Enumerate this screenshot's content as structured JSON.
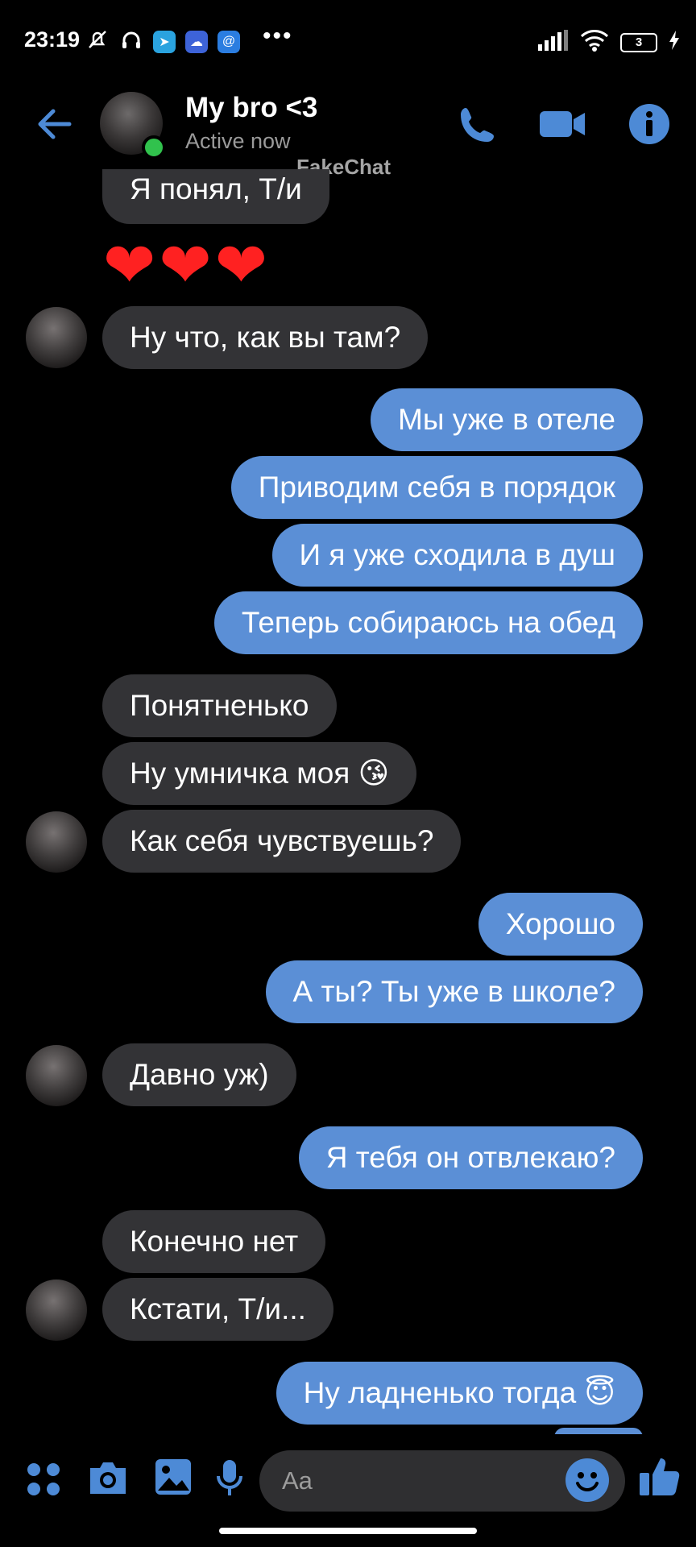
{
  "status_bar": {
    "time": "23:19",
    "battery": "3"
  },
  "header": {
    "name": "My bro <3",
    "status": "Active now",
    "watermark": "FakeChat"
  },
  "messages": {
    "m0": "Я понял, Т/и",
    "hearts": "❤❤❤",
    "m1": "Ну что, как вы там?",
    "m2": "Мы уже в отеле",
    "m3": "Приводим себя в порядок",
    "m4": "И я уже сходила в душ",
    "m5": "Теперь собираюсь на обед",
    "m6": "Понятненько",
    "m7": "Ну умничка моя 😘",
    "m8": "Как себя чувствуешь?",
    "m9": "Хорошо",
    "m10": "А ты? Ты уже в школе?",
    "m11": "Давно уж)",
    "m12": "Я тебя он отвлекаю?",
    "m13": "Конечно нет",
    "m14": "Кстати, Т/и...",
    "m15": "Ну ладненько тогда 😇"
  },
  "composer": {
    "placeholder": "Aa"
  },
  "colors": {
    "accent": "#5b8fd6",
    "incoming_bubble": "#333336",
    "online": "#31c24d"
  }
}
